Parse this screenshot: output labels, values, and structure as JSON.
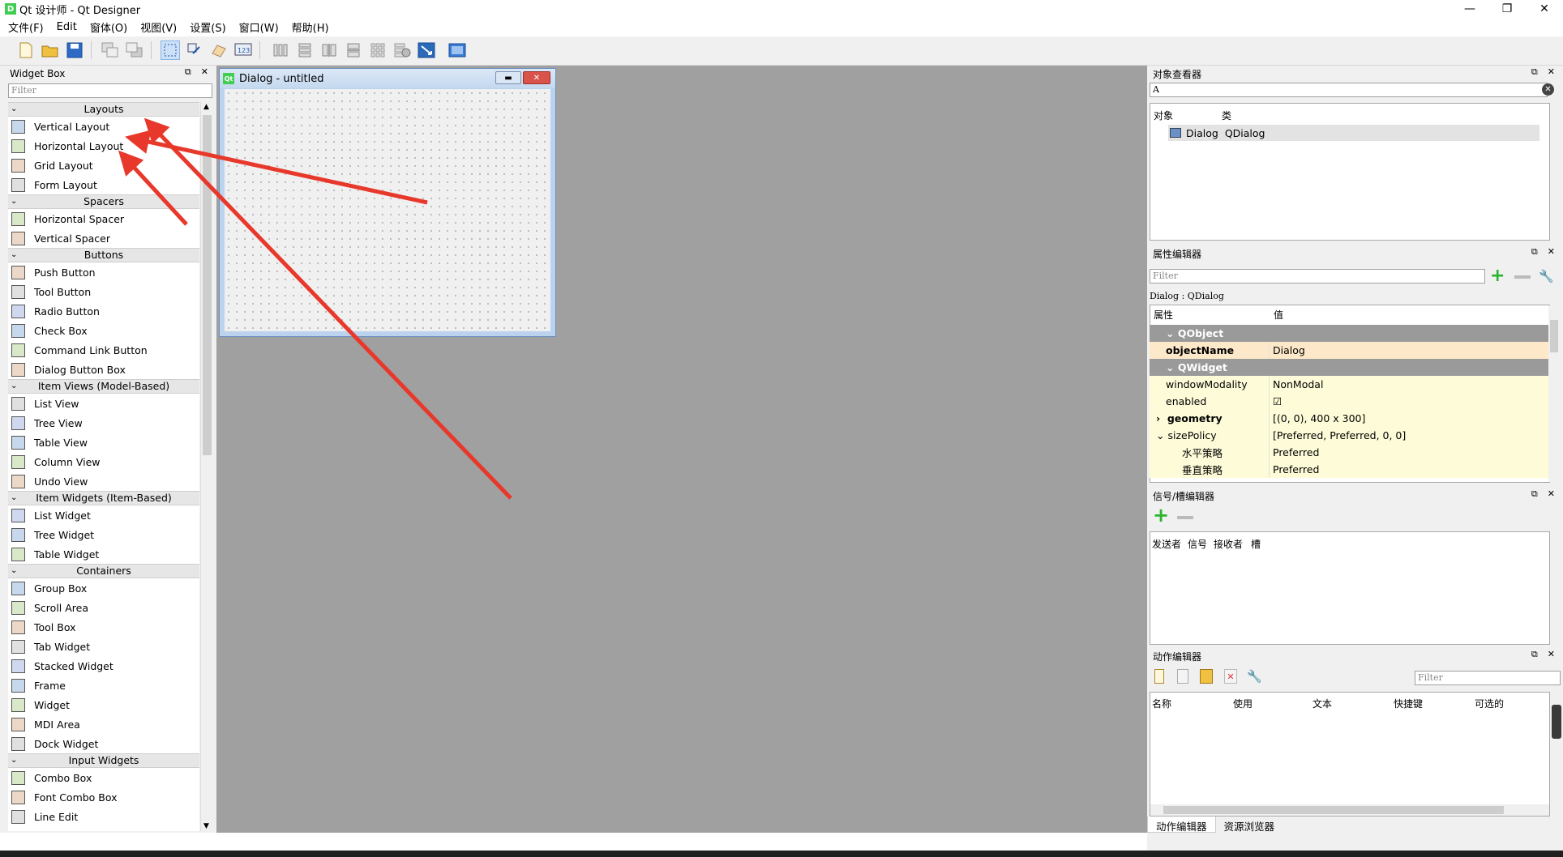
{
  "window": {
    "app_icon": "D",
    "title": "Qt 设计师 - Qt Designer",
    "min": "—",
    "max": "❐",
    "close": "✕"
  },
  "menu": [
    "文件(F)",
    "Edit",
    "窗体(O)",
    "视图(V)",
    "设置(S)",
    "窗口(W)",
    "帮助(H)"
  ],
  "widget_box": {
    "title": "Widget Box",
    "filter_placeholder": "Filter",
    "categories": [
      {
        "name": "Layouts",
        "items": [
          "Vertical Layout",
          "Horizontal Layout",
          "Grid Layout",
          "Form Layout"
        ]
      },
      {
        "name": "Spacers",
        "items": [
          "Horizontal Spacer",
          "Vertical Spacer"
        ]
      },
      {
        "name": "Buttons",
        "items": [
          "Push Button",
          "Tool Button",
          "Radio Button",
          "Check Box",
          "Command Link Button",
          "Dialog Button Box"
        ]
      },
      {
        "name": "Item Views (Model-Based)",
        "items": [
          "List View",
          "Tree View",
          "Table View",
          "Column View",
          "Undo View"
        ]
      },
      {
        "name": "Item Widgets (Item-Based)",
        "items": [
          "List Widget",
          "Tree Widget",
          "Table Widget"
        ]
      },
      {
        "name": "Containers",
        "items": [
          "Group Box",
          "Scroll Area",
          "Tool Box",
          "Tab Widget",
          "Stacked Widget",
          "Frame",
          "Widget",
          "MDI Area",
          "Dock Widget"
        ]
      },
      {
        "name": "Input Widgets",
        "items": [
          "Combo Box",
          "Font Combo Box",
          "Line Edit"
        ]
      }
    ]
  },
  "dialog": {
    "icon": "Qt",
    "title": "Dialog - untitled"
  },
  "object_inspector": {
    "title": "对象查看器",
    "filter_value": "A",
    "col_object": "对象",
    "col_class": "类",
    "row_object": "Dialog",
    "row_class": "QDialog"
  },
  "property_editor": {
    "title": "属性编辑器",
    "filter_placeholder": "Filter",
    "context": "Dialog : QDialog",
    "col_prop": "属性",
    "col_value": "值",
    "rows": [
      {
        "k": "QObject",
        "v": ""
      },
      {
        "k": "objectName",
        "v": "Dialog"
      },
      {
        "k": "QWidget",
        "v": ""
      },
      {
        "k": "windowModality",
        "v": "NonModal"
      },
      {
        "k": "enabled",
        "v": "☑"
      },
      {
        "k": "geometry",
        "v": "[(0, 0), 400 x 300]"
      },
      {
        "k": "sizePolicy",
        "v": "[Preferred, Preferred, 0, 0]"
      },
      {
        "k": "水平策略",
        "v": "Preferred"
      },
      {
        "k": "垂直策略",
        "v": "Preferred"
      }
    ]
  },
  "signal_slot_editor": {
    "title": "信号/槽编辑器",
    "cols": [
      "发送者",
      "信号",
      "接收者",
      "槽"
    ]
  },
  "action_editor": {
    "title": "动作编辑器",
    "filter_placeholder": "Filter",
    "cols": [
      "名称",
      "使用",
      "文本",
      "快捷键",
      "可选的"
    ]
  },
  "bottom_tabs": [
    "动作编辑器",
    "资源浏览器"
  ],
  "colors": {
    "arrow": "#e8382b",
    "qt_green": "#41cd52",
    "central_bg": "#a0a0a0"
  }
}
